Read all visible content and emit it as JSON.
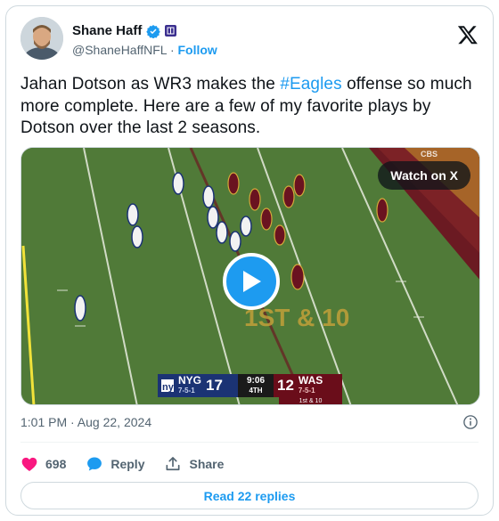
{
  "author": {
    "display_name": "Shane Haff",
    "handle": "@ShaneHaffNFL",
    "separator": "·",
    "follow_label": "Follow"
  },
  "tweet": {
    "text_before": "Jahan Dotson as WR3 makes the ",
    "hashtag": "#Eagles",
    "text_after": " offense so much more complete. Here are a few of my favorite plays by Dotson over the last 2 seasons."
  },
  "media": {
    "watch_label": "Watch on X",
    "play_icon": "play-icon",
    "scorebug": {
      "away_abbr": "NYG",
      "away_record": "7-5-1",
      "away_score": "17",
      "clock": "9:06",
      "quarter": "4TH",
      "home_score": "12",
      "home_abbr": "WAS",
      "home_record": "7-5-1",
      "down_distance": "1st & 10"
    },
    "field_graphic_text": "1ST & 10"
  },
  "meta": {
    "timestamp": "1:01 PM · Aug 22, 2024"
  },
  "actions": {
    "likes": "698",
    "reply_label": "Reply",
    "share_label": "Share"
  },
  "replies_button": "Read 22 replies",
  "colors": {
    "accent": "#1d9bf0",
    "like": "#f91880",
    "text": "#0f1419",
    "muted": "#536471",
    "border": "#cfd9de"
  }
}
